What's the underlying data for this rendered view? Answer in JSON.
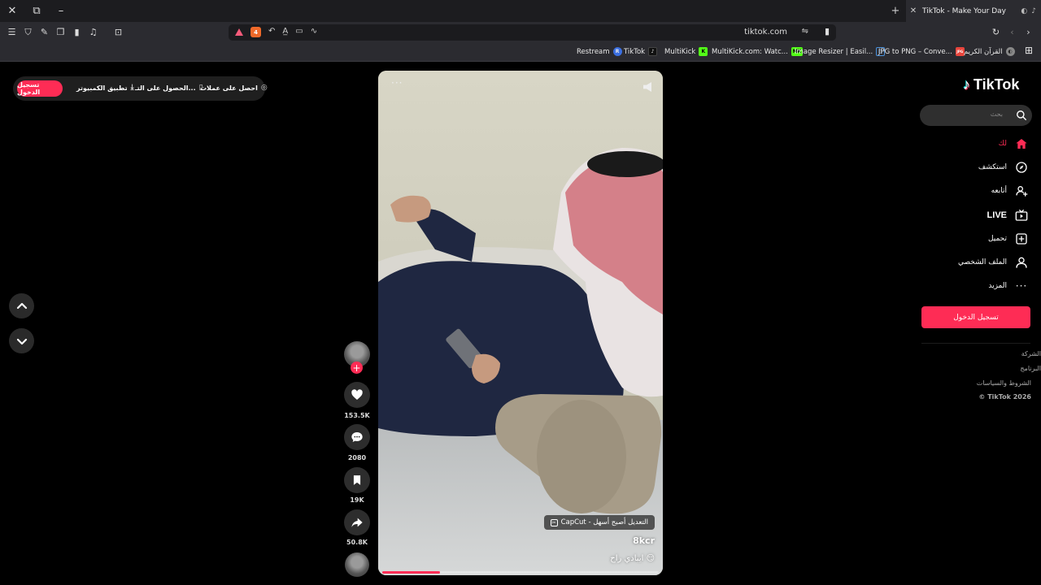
{
  "browser": {
    "tab_title": "TikTok - Make Your Day",
    "url": "tiktok.com",
    "shield_count": "4",
    "bookmarks": [
      {
        "label": "Restream",
        "badge": "R",
        "color": "#3b6fe0"
      },
      {
        "label": "TikTok",
        "badge": "♪",
        "color": "#111111"
      },
      {
        "label": "MultiKick",
        "badge": "K",
        "color": "#53fc18"
      },
      {
        "label": "MultiKick.com: Watc...",
        "badge": "MK",
        "color": "#53fc18"
      },
      {
        "label": "Image Resizer | Easil...",
        "badge": "▢",
        "color": "#4a90d9"
      },
      {
        "label": "JPG to PNG – Conve...",
        "badge": "JPG",
        "color": "#e8453c"
      },
      {
        "label": "القرآن الكريم",
        "badge": "◐",
        "color": "#888888"
      }
    ]
  },
  "topbar": {
    "login": "تسجيل الدخول",
    "desktop_app": "تطبيق الكمبيوتر",
    "get_app": "الحصول على التـ...",
    "get_coins": "احصل على عملات"
  },
  "video": {
    "capcut_label": "CapCut - التعديل أصبح أسهل",
    "author": "8kcr",
    "caption": "ايبادي راح 😏",
    "progress": 0.21
  },
  "actions": {
    "likes": "153.5K",
    "comments": "2080",
    "saves": "19K",
    "shares": "50.8K"
  },
  "sidebar": {
    "logo": "TikTok",
    "search_placeholder": "بحث",
    "items": [
      {
        "label": "لك",
        "icon": "home-icon"
      },
      {
        "label": "استكشف",
        "icon": "compass-icon"
      },
      {
        "label": "أتابعه",
        "icon": "user-plus-icon"
      },
      {
        "label": "LIVE",
        "icon": "live-tv-icon"
      },
      {
        "label": "تحميل",
        "icon": "upload-icon"
      },
      {
        "label": "الملف الشخصي",
        "icon": "profile-icon"
      },
      {
        "label": "المزيد",
        "icon": "more-icon"
      }
    ],
    "login_button": "تسجيل الدخول",
    "footer": [
      "الشركة",
      "البرنامج",
      "الشروط والسياسات"
    ],
    "copyright": "© TikTok 2026"
  },
  "colors": {
    "accent": "#fe2c55",
    "background": "#000000"
  }
}
